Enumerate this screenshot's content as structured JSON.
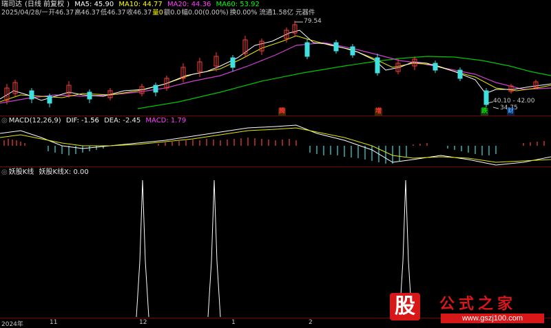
{
  "app": {
    "title": "瑞司达",
    "period": "日线 前复权"
  },
  "main_header": {
    "ma5": "MA5: 45.90",
    "ma10": "MA10: 44.77",
    "ma20": "MA20: 44.36",
    "ma60": "MA60: 53.92",
    "colors": {
      "ma5": "#ffffff",
      "ma10": "#ffff00",
      "ma20": "#ff00ff",
      "ma60": "#00ff00"
    }
  },
  "info_line": {
    "date": "2025/04/28/一",
    "open": "开46.37",
    "high": "高46.37",
    "low": "低46.37",
    "close": "收46.37",
    "volume": "量0",
    "amount": "额0.0",
    "change": "幅0.00(0.00%)",
    "turnover": "换0.00%",
    "float": "流通1.58亿 元器件"
  },
  "annotations": {
    "high_price": "79.54",
    "range": "40.10 - 42.00",
    "low_price": "34.75",
    "signals": [
      {
        "text": "腾",
        "color": "#ff3030"
      },
      {
        "text": "增",
        "color": "#ff3030"
      },
      {
        "text": "跌",
        "color": "#00e000"
      },
      {
        "text": "财",
        "color": "#3aa0ff"
      }
    ]
  },
  "macd_header": {
    "name": "MACD(12,26,9)",
    "dif": "DIF: -1.56",
    "dea": "DEA: -2.45",
    "macd": "MACD: 1.79"
  },
  "indicator_header": {
    "name": "妖股K线",
    "value": "妖股K线X: 0.00"
  },
  "date_axis": [
    "2024年",
    "11",
    "12",
    "1",
    "2"
  ],
  "logo": {
    "badge": "股",
    "text": "公式之家",
    "url": "www.gszj100.com"
  }
}
